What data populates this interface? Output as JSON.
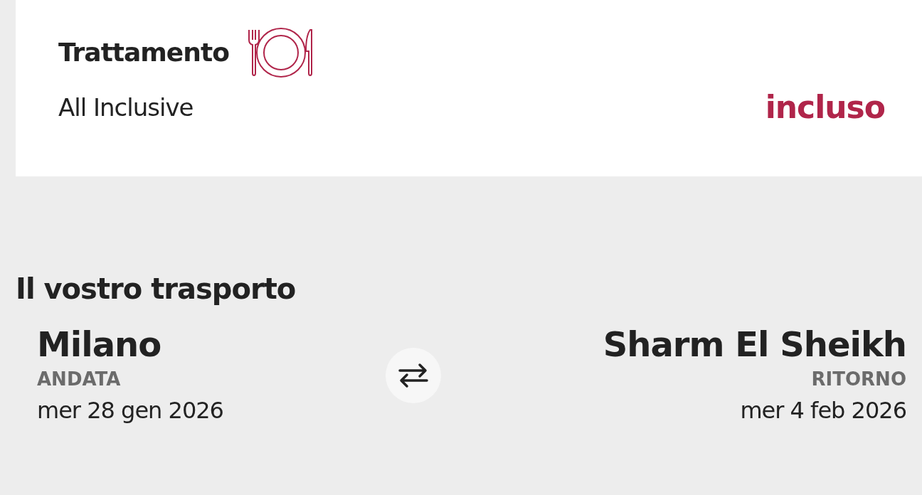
{
  "board": {
    "title": "Trattamento",
    "value": "All Inclusive",
    "price": "incluso"
  },
  "transport": {
    "title": "Il vostro trasporto",
    "legs": [
      {
        "city": "Milano",
        "label": "ANDATA",
        "date": "mer 28 gen 2026"
      },
      {
        "city": "Sharm El Sheikh",
        "label": "RITORNO",
        "date": "mer 4 feb 2026"
      }
    ]
  }
}
